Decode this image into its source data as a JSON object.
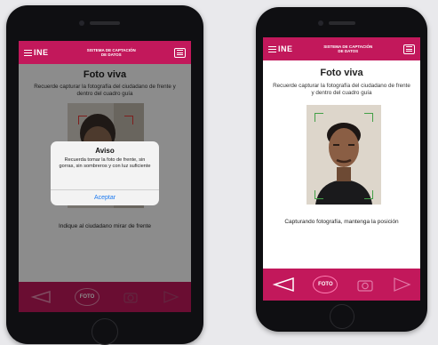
{
  "header": {
    "logo": "INE",
    "title": "SISTEMA DE CAPTACIÓN DE DATOS"
  },
  "screens": {
    "left": {
      "title": "Foto viva",
      "instruction": "Recuerde capturar la fotografía del ciudadano de frente y dentro del cuadro guía",
      "status": "Indique al ciudadano mirar de frente",
      "frame_color": "#e53935",
      "foto_label": "FOTO"
    },
    "right": {
      "title": "Foto viva",
      "instruction": "Recuerde capturar la fotografía del ciudadano de frente y dentro del cuadro guía",
      "status": "Capturando fotografía, mantenga la posición",
      "frame_color": "#43a047",
      "foto_label": "FOTO"
    }
  },
  "dialog": {
    "title": "Aviso",
    "message": "Recuerda tomar la foto de frente, sin gorras, sin sombreros y con luz suficiente",
    "button": "Aceptar"
  },
  "colors": {
    "brand": "#c2185b",
    "accent_button": "#1e7bf0"
  },
  "icons": [
    "menu-icon",
    "back-arrow-icon",
    "camera-icon",
    "forward-arrow-icon"
  ]
}
